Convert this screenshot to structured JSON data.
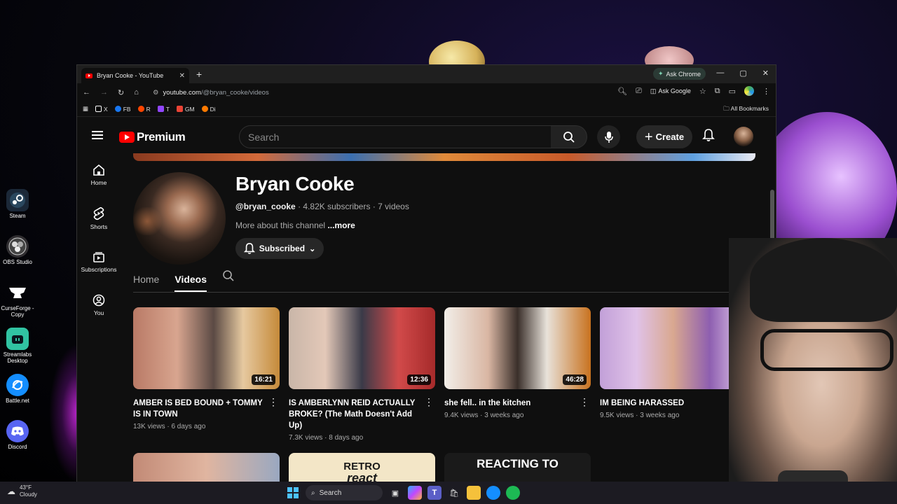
{
  "desktop": {
    "icons": [
      {
        "label": "Steam",
        "icon": "steam-icon",
        "color": "#1b2838"
      },
      {
        "label": "OBS Studio",
        "icon": "obs-icon",
        "color": "#302e31"
      },
      {
        "label": "CurseForge - Copy",
        "icon": "curseforge-icon",
        "color": "#f16436"
      },
      {
        "label": "Streamlabs Desktop",
        "icon": "streamlabs-icon",
        "color": "#31c3a2"
      },
      {
        "label": "Battle.net",
        "icon": "battlenet-icon",
        "color": "#148eff"
      },
      {
        "label": "Discord",
        "icon": "discord-icon",
        "color": "#5865f2"
      }
    ]
  },
  "browser": {
    "tab_title": "Bryan Cooke - YouTube",
    "ask_chrome": "Ask Chrome",
    "url_host": "youtube.com",
    "url_path": "/@bryan_cooke/videos",
    "ask_google": "Ask Google",
    "bookmarks": [
      {
        "label": "X",
        "color": "#ffffff"
      },
      {
        "label": "FB",
        "color": "#1877f2"
      },
      {
        "label": "R",
        "color": "#ff4500"
      },
      {
        "label": "T",
        "color": "#9146ff"
      },
      {
        "label": "GM",
        "color": "#ea4335"
      },
      {
        "label": "Di",
        "color": "#ff7a00"
      }
    ],
    "all_bookmarks": "All Bookmarks"
  },
  "youtube": {
    "logo_text": "Premium",
    "search_placeholder": "Search",
    "create_label": "Create",
    "guide": [
      {
        "label": "Home",
        "icon": "home-icon"
      },
      {
        "label": "Shorts",
        "icon": "shorts-icon"
      },
      {
        "label": "Subscriptions",
        "icon": "subscriptions-icon"
      },
      {
        "label": "You",
        "icon": "you-icon"
      }
    ],
    "channel": {
      "name": "Bryan Cooke",
      "handle": "@bryan_cooke",
      "subscribers": "4.82K subscribers",
      "videos": "7 videos",
      "more_about": "More about this channel",
      "more_link": "...more",
      "subscribed_label": "Subscribed"
    },
    "tabs": [
      "Home",
      "Videos"
    ],
    "videos": [
      {
        "title": "AMBER IS BED BOUND + TOMMY IS IN TOWN",
        "duration": "16:21",
        "views": "13K views",
        "age": "6 days ago"
      },
      {
        "title": "IS AMBERLYNN REID ACTUALLY BROKE? (The Math Doesn't Add Up)",
        "duration": "12:36",
        "views": "7.3K views",
        "age": "8 days ago"
      },
      {
        "title": "she fell.. in the kitchen",
        "duration": "46:28",
        "views": "9.4K views",
        "age": "3 weeks ago"
      },
      {
        "title": "IM BEING HARASSED",
        "duration": "",
        "views": "9.5K views",
        "age": "3 weeks ago"
      }
    ],
    "row2": {
      "retro_line1": "RETRO",
      "retro_line2": "react",
      "reacting": "REACTING TO"
    }
  },
  "taskbar": {
    "temp": "43°F",
    "weather": "Cloudy",
    "search": "Search"
  }
}
